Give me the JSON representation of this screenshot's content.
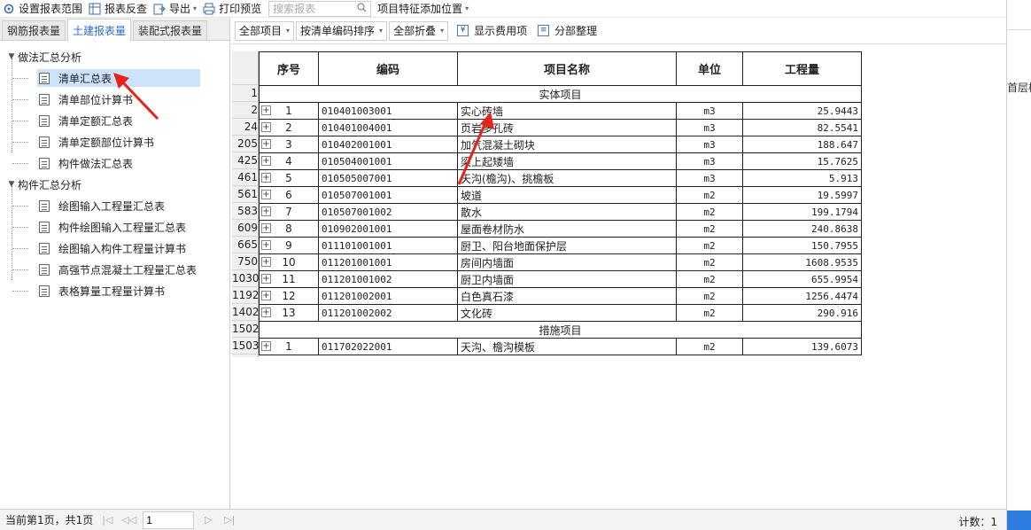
{
  "toolbar": {
    "set_range": "设置报表范围",
    "review": "报表反查",
    "export": "导出",
    "print_preview": "打印预览",
    "search_placeholder": "搜索报表",
    "feature_position": "项目特征添加位置"
  },
  "tabs": [
    "钢筋报表量",
    "土建报表量",
    "装配式报表量"
  ],
  "tree": {
    "group1": "做法汇总分析",
    "group1_items": [
      "清单汇总表",
      "清单部位计算书",
      "清单定额汇总表",
      "清单定额部位计算书",
      "构件做法汇总表"
    ],
    "group2": "构件汇总分析",
    "group2_items": [
      "绘图输入工程量汇总表",
      "构件绘图输入工程量汇总表",
      "绘图输入构件工程量计算书",
      "高强节点混凝土工程量汇总表",
      "表格算量工程量计算书"
    ]
  },
  "subbar": {
    "all_items": "全部项目",
    "sort": "按清单编码排序",
    "collapse": "全部折叠",
    "show_cost": "显示费用项",
    "section": "分部整理"
  },
  "table": {
    "headers": [
      "序号",
      "编码",
      "项目名称",
      "单位",
      "工程量"
    ],
    "group_title_1": "实体项目",
    "group_title_2": "措施项目",
    "row_numbers": [
      "1",
      "2",
      "24",
      "205",
      "425",
      "461",
      "561",
      "583",
      "609",
      "665",
      "750",
      "1030",
      "1192",
      "1402",
      "1502",
      "1503"
    ],
    "rows": [
      {
        "no": "1",
        "code": "010401003001",
        "name": "实心砖墙",
        "unit": "m3",
        "qty": "25.9443"
      },
      {
        "no": "2",
        "code": "010401004001",
        "name": "页岩多孔砖",
        "unit": "m3",
        "qty": "82.5541"
      },
      {
        "no": "3",
        "code": "010402001001",
        "name": "加气混凝土砌块",
        "unit": "m3",
        "qty": "188.647"
      },
      {
        "no": "4",
        "code": "010504001001",
        "name": "梁上起矮墙",
        "unit": "m3",
        "qty": "15.7625"
      },
      {
        "no": "5",
        "code": "010505007001",
        "name": "天沟(檐沟)、挑檐板",
        "unit": "m3",
        "qty": "5.913"
      },
      {
        "no": "6",
        "code": "010507001001",
        "name": "坡道",
        "unit": "m2",
        "qty": "19.5997"
      },
      {
        "no": "7",
        "code": "010507001002",
        "name": "散水",
        "unit": "m2",
        "qty": "199.1794"
      },
      {
        "no": "8",
        "code": "010902001001",
        "name": "屋面卷材防水",
        "unit": "m2",
        "qty": "240.8638"
      },
      {
        "no": "9",
        "code": "011101001001",
        "name": "厨卫、阳台地面保护层",
        "unit": "m2",
        "qty": "150.7955"
      },
      {
        "no": "10",
        "code": "011201001001",
        "name": "房间内墙面",
        "unit": "m2",
        "qty": "1608.9535"
      },
      {
        "no": "11",
        "code": "011201001002",
        "name": "厨卫内墙面",
        "unit": "m2",
        "qty": "655.9954"
      },
      {
        "no": "12",
        "code": "011201002001",
        "name": "白色真石漆",
        "unit": "m2",
        "qty": "1256.4474"
      },
      {
        "no": "13",
        "code": "011201002002",
        "name": "文化砖",
        "unit": "m2",
        "qty": "290.916"
      }
    ],
    "measure_rows": [
      {
        "no": "1",
        "code": "011702022001",
        "name": "天沟、檐沟模板",
        "unit": "m2",
        "qty": "139.6073"
      }
    ]
  },
  "status": {
    "page_info": "当前第1页，共1页",
    "page_value": "1",
    "count": "计数：1"
  },
  "right_panel_text": "首层楼"
}
